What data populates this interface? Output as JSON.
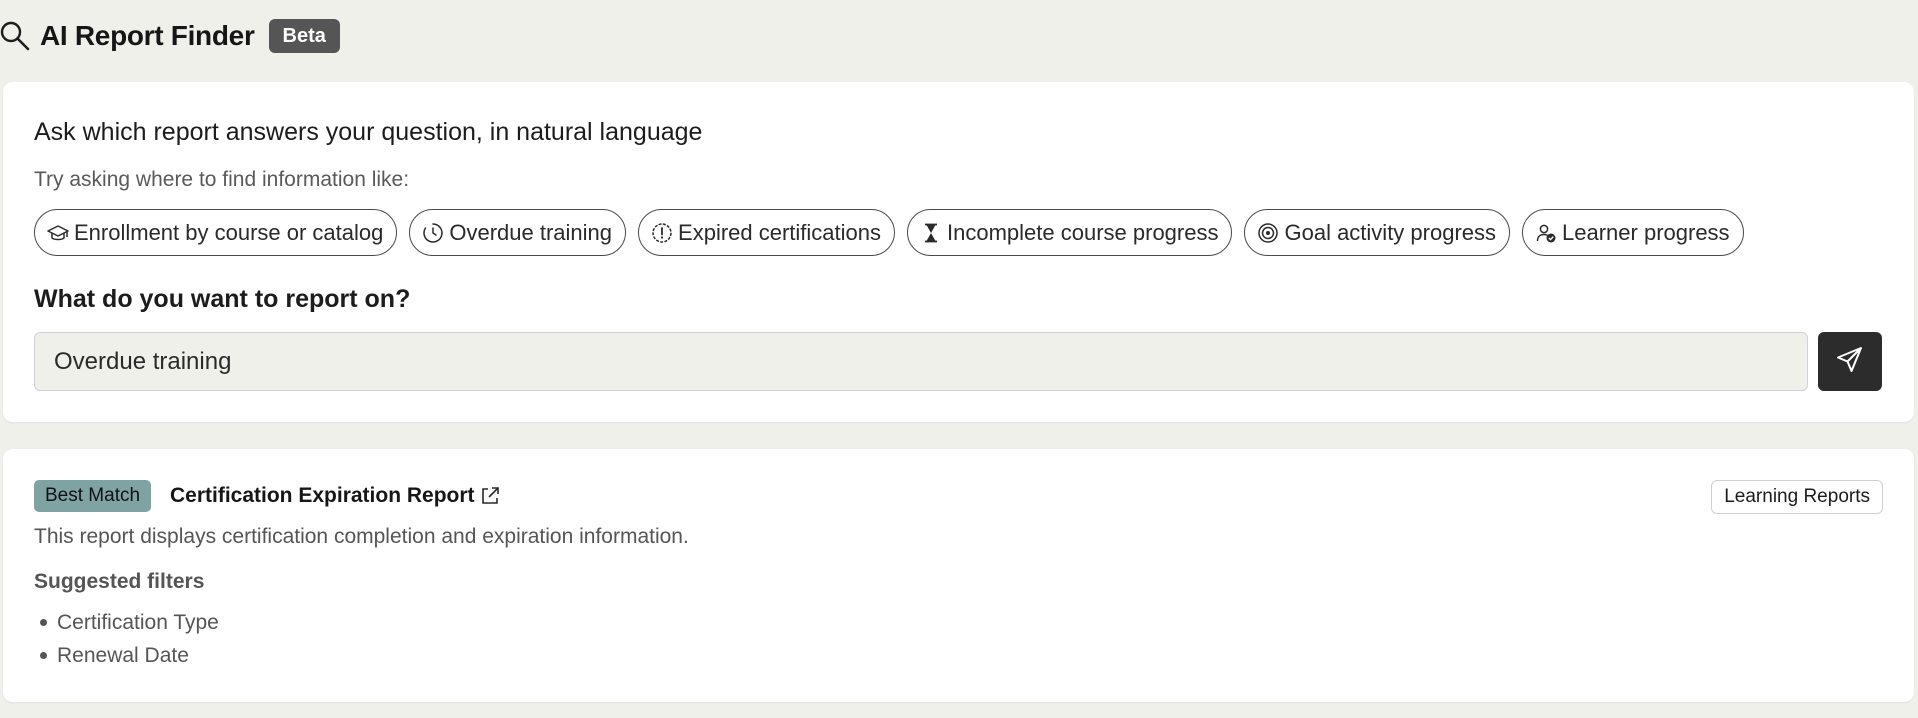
{
  "header": {
    "title": "AI Report Finder",
    "badge": "Beta",
    "icon": "search-icon"
  },
  "ask": {
    "heading": "Ask which report answers your question, in natural language",
    "hint": "Try asking where to find information like:",
    "suggestions": [
      {
        "label": "Enrollment by course or catalog",
        "icon": "graduation-cap-icon"
      },
      {
        "label": "Overdue training",
        "icon": "clock-icon"
      },
      {
        "label": "Expired certifications",
        "icon": "alert-circle-icon"
      },
      {
        "label": "Incomplete course progress",
        "icon": "hourglass-icon"
      },
      {
        "label": "Goal activity progress",
        "icon": "target-icon"
      },
      {
        "label": "Learner progress",
        "icon": "user-check-icon"
      }
    ],
    "input_label": "What do you want to report on?",
    "input_value": "Overdue training",
    "send_icon": "send-icon"
  },
  "result": {
    "badge": "Best Match",
    "title": "Certification Expiration Report",
    "category": "Learning Reports",
    "description": "This report displays certification completion and expiration information.",
    "filters_heading": "Suggested filters",
    "filters": [
      "Certification Type",
      "Renewal Date"
    ]
  },
  "colors": {
    "page_bg": "#f0f0eb",
    "card_bg": "#ffffff",
    "beta_bg": "#555555",
    "best_match_bg": "#7fa3a3",
    "send_button_bg": "#2c2c2c",
    "input_bg": "#f0f0eb"
  }
}
